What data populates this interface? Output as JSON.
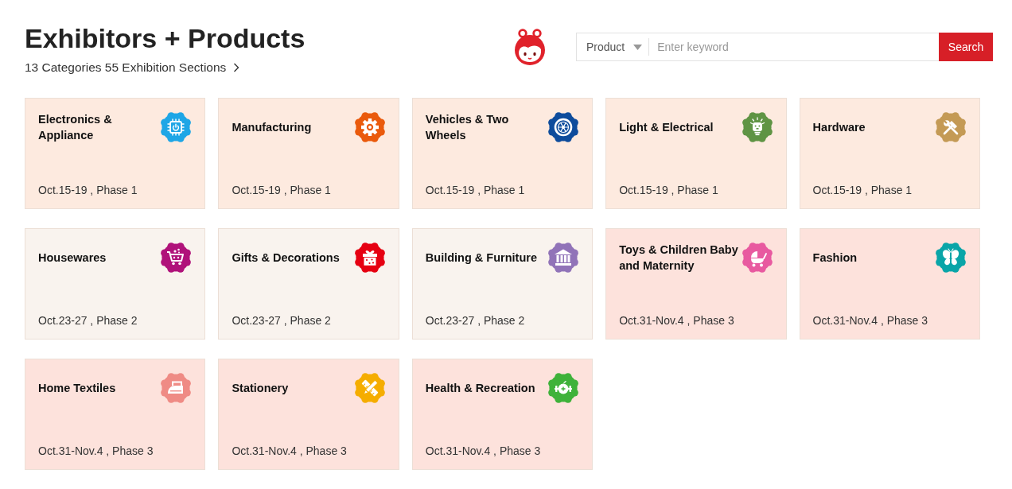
{
  "header": {
    "title": "Exhibitors + Products",
    "subtitle": "13 Categories 55 Exhibition Sections"
  },
  "search": {
    "scope": "Product",
    "placeholder": "Enter keyword",
    "button": "Search"
  },
  "phases": [
    {
      "color": "#fdeadf",
      "categories": [
        {
          "name": "Electronics & Appliance",
          "date": "Oct.15-19 , Phase 1",
          "color": "#1ea6e6"
        },
        {
          "name": "Manufacturing",
          "date": "Oct.15-19 , Phase 1",
          "color": "#ea5a0c"
        },
        {
          "name": "Vehicles & Two Wheels",
          "date": "Oct.15-19 , Phase 1",
          "color": "#0e4c9c"
        },
        {
          "name": "Light & Electrical",
          "date": "Oct.15-19 , Phase 1",
          "color": "#5f9444"
        },
        {
          "name": "Hardware",
          "date": "Oct.15-19 , Phase 1",
          "color": "#c49a55"
        }
      ]
    },
    {
      "color": "#f9f3ee",
      "categories": [
        {
          "name": "Housewares",
          "date": "Oct.23-27 , Phase 2",
          "color": "#b0127a"
        },
        {
          "name": "Gifts & Decorations",
          "date": "Oct.23-27 , Phase 2",
          "color": "#e60012"
        },
        {
          "name": "Building & Furniture",
          "date": "Oct.23-27 , Phase 2",
          "color": "#9173b8"
        }
      ]
    },
    {
      "color": "#fde2dc",
      "categories": [
        {
          "name": "Toys & Children Baby and Maternity",
          "date": "Oct.31-Nov.4 , Phase 3",
          "color": "#e85aa0"
        },
        {
          "name": "Fashion",
          "date": "Oct.31-Nov.4 , Phase 3",
          "color": "#0aa5a8"
        },
        {
          "name": "Home Textiles",
          "date": "Oct.31-Nov.4 , Phase 3",
          "color": "#ef8b85"
        },
        {
          "name": "Stationery",
          "date": "Oct.31-Nov.4 , Phase 3",
          "color": "#f5ad00"
        },
        {
          "name": "Health & Recreation",
          "date": "Oct.31-Nov.4 , Phase 3",
          "color": "#3fb23a"
        }
      ]
    }
  ]
}
